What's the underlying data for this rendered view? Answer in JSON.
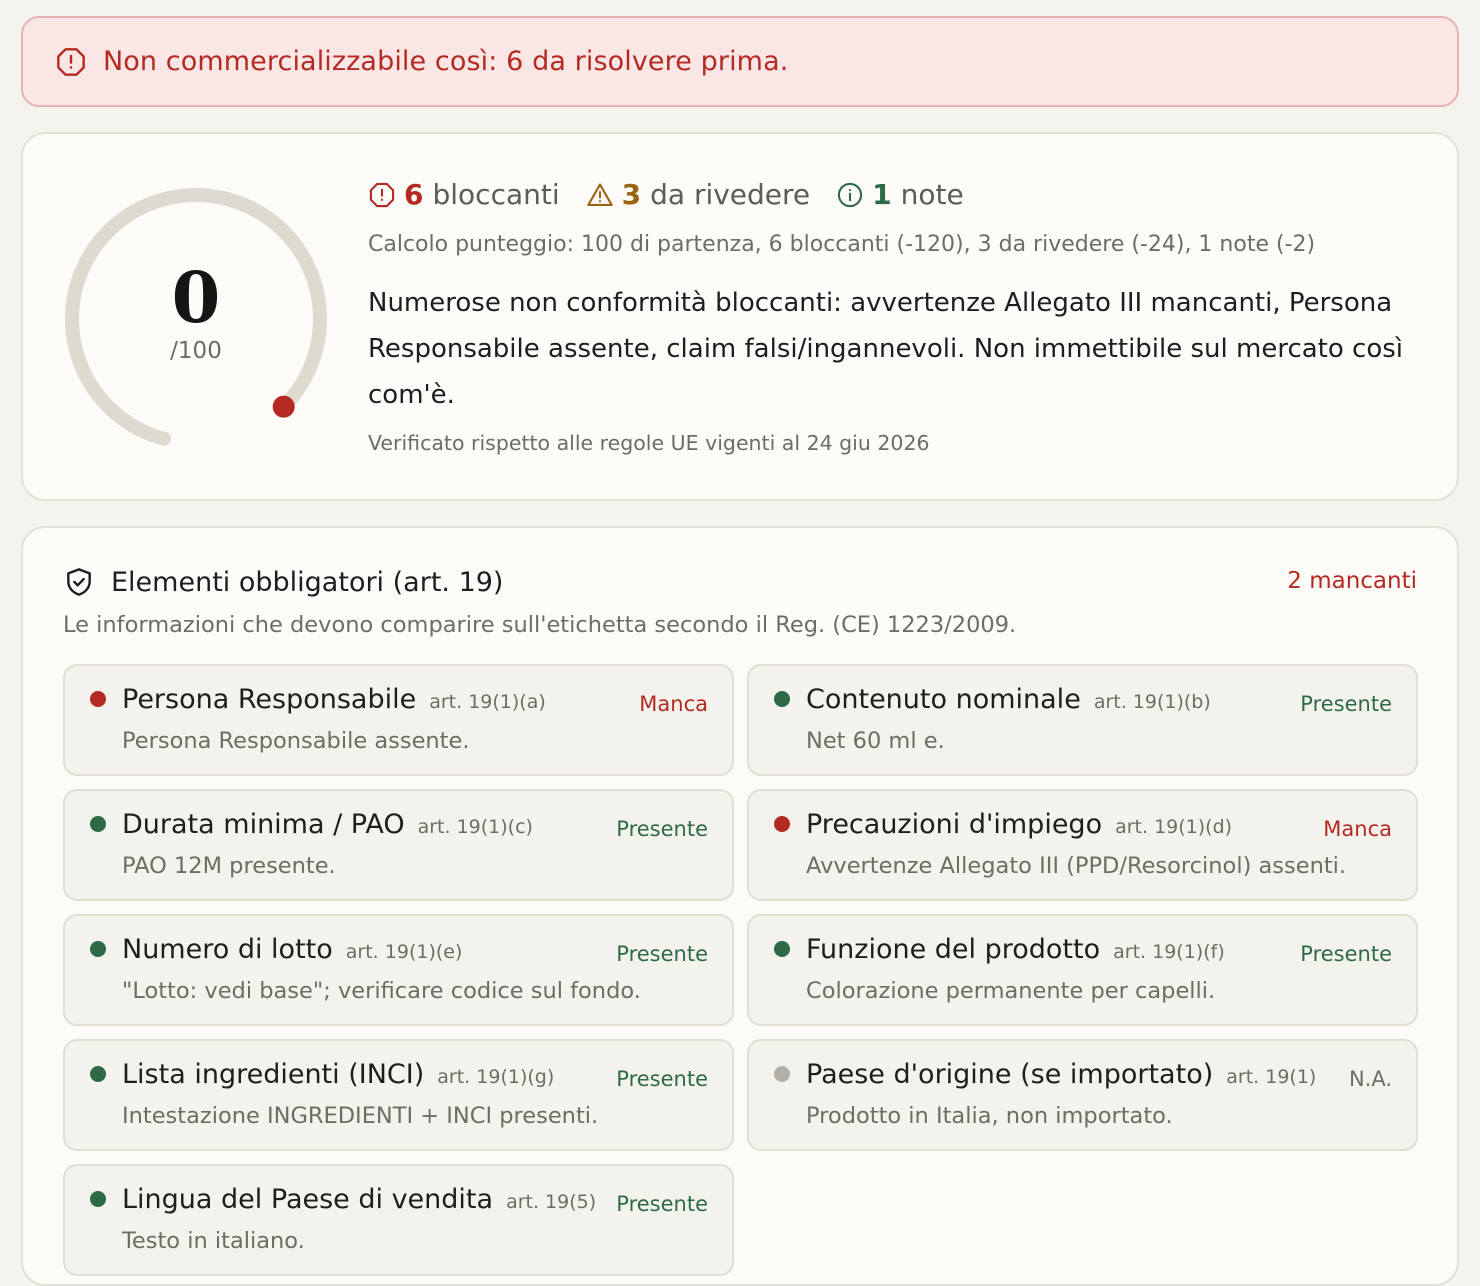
{
  "banner": {
    "icon": "alert-octagon-icon",
    "text": "Non commercializzabile così: 6 da risolvere prima.",
    "color": "#b42a22"
  },
  "score": {
    "value": "0",
    "max": "/100",
    "fraction": 0.0,
    "counts": {
      "blocking": {
        "icon": "alert-octagon-icon",
        "count": "6",
        "label": "bloccanti"
      },
      "review": {
        "icon": "warning-triangle-icon",
        "count": "3",
        "label": "da rivedere"
      },
      "notes": {
        "icon": "info-circle-icon",
        "count": "1",
        "label": "note"
      }
    },
    "calculation": "Calcolo punteggio: 100 di partenza, 6 bloccanti (-120), 3 da rivedere (-24), 1 note (-2)",
    "summary": "Numerose non conformità bloccanti: avvertenze Allegato III mancanti, Persona Responsabile assente, claim falsi/ingannevoli. Non immettibile sul mercato così com'è.",
    "verified": "Verificato rispetto alle regole UE vigenti al 24 giu 2026"
  },
  "elements": {
    "icon": "shield-check-icon",
    "title": "Elementi obbligatori (art. 19)",
    "missing_count": "2 mancanti",
    "description": "Le informazioni che devono comparire sull'etichetta secondo il Reg. (CE) 1223/2009.",
    "items": [
      {
        "name": "Persona Responsabile",
        "article": "art. 19(1)(a)",
        "status": "Manca",
        "state": "red",
        "detail": "Persona Responsabile assente."
      },
      {
        "name": "Contenuto nominale",
        "article": "art. 19(1)(b)",
        "status": "Presente",
        "state": "green",
        "detail": "Net 60 ml e."
      },
      {
        "name": "Durata minima / PAO",
        "article": "art. 19(1)(c)",
        "status": "Presente",
        "state": "green",
        "detail": "PAO 12M presente."
      },
      {
        "name": "Precauzioni d'impiego",
        "article": "art. 19(1)(d)",
        "status": "Manca",
        "state": "red",
        "detail": "Avvertenze Allegato III (PPD/Resorcinol) assenti."
      },
      {
        "name": "Numero di lotto",
        "article": "art. 19(1)(e)",
        "status": "Presente",
        "state": "green",
        "detail": "\"Lotto: vedi base\"; verificare codice sul fondo."
      },
      {
        "name": "Funzione del prodotto",
        "article": "art. 19(1)(f)",
        "status": "Presente",
        "state": "green",
        "detail": "Colorazione permanente per capelli."
      },
      {
        "name": "Lista ingredienti (INCI)",
        "article": "art. 19(1)(g)",
        "status": "Presente",
        "state": "green",
        "detail": "Intestazione INGREDIENTI + INCI presenti."
      },
      {
        "name": "Paese d'origine (se importato)",
        "article": "art. 19(1)",
        "status": "N.A.",
        "state": "gray",
        "detail": "Prodotto in Italia, non importato."
      },
      {
        "name": "Lingua del Paese di vendita",
        "article": "art. 19(5)",
        "status": "Presente",
        "state": "green",
        "detail": "Testo in italiano."
      }
    ]
  },
  "colors": {
    "red": "#b42a22",
    "green": "#2f6a47",
    "amber": "#9a6410",
    "track": "#dedad0"
  }
}
